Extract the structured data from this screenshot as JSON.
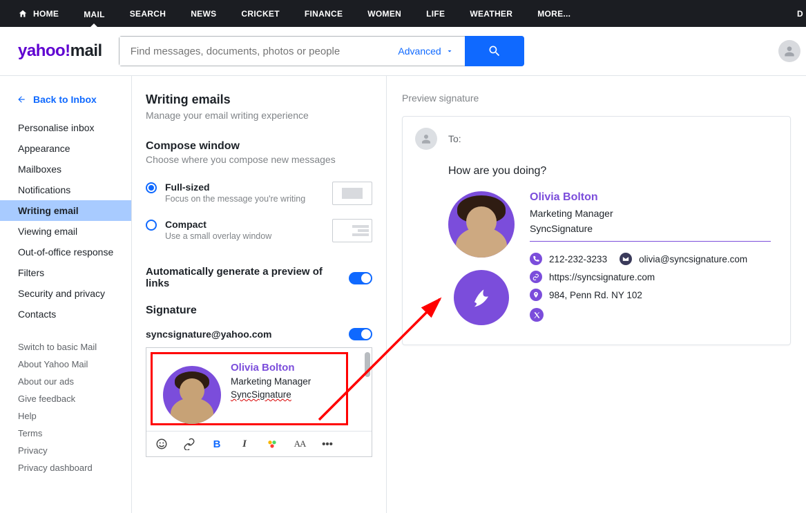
{
  "topnav": {
    "items": [
      "HOME",
      "MAIL",
      "SEARCH",
      "NEWS",
      "CRICKET",
      "FINANCE",
      "WOMEN",
      "LIFE",
      "WEATHER",
      "MORE..."
    ]
  },
  "logo": {
    "brand": "yahoo!",
    "product": "mail"
  },
  "search": {
    "placeholder": "Find messages, documents, photos or people",
    "advanced": "Advanced"
  },
  "back": "Back to Inbox",
  "sidebar": {
    "primary": [
      "Personalise inbox",
      "Appearance",
      "Mailboxes",
      "Notifications",
      "Writing email",
      "Viewing email",
      "Out-of-office response",
      "Filters",
      "Security and privacy",
      "Contacts"
    ],
    "active_index": 4,
    "secondary": [
      "Switch to basic Mail",
      "About Yahoo Mail",
      "About our ads",
      "Give feedback",
      "Help",
      "Terms",
      "Privacy",
      "Privacy dashboard"
    ]
  },
  "center": {
    "title": "Writing emails",
    "subtitle": "Manage your email writing experience",
    "compose_title": "Compose window",
    "compose_sub": "Choose where you compose new messages",
    "opt_full": {
      "label": "Full-sized",
      "sub": "Focus on the message you're writing"
    },
    "opt_compact": {
      "label": "Compact",
      "sub": "Use a small overlay window"
    },
    "link_preview": "Automatically generate a preview of links",
    "sig_heading": "Signature",
    "sig_email": "syncsignature@yahoo.com"
  },
  "signature": {
    "name": "Olivia Bolton",
    "title": "Marketing Manager",
    "company": "SyncSignature",
    "phone": "212-232-3233",
    "email": "olivia@syncsignature.com",
    "website": "https://syncsignature.com",
    "address": "984, Penn Rd. NY 102"
  },
  "preview": {
    "label": "Preview signature",
    "to": "To:",
    "greeting": "How are you doing?"
  }
}
